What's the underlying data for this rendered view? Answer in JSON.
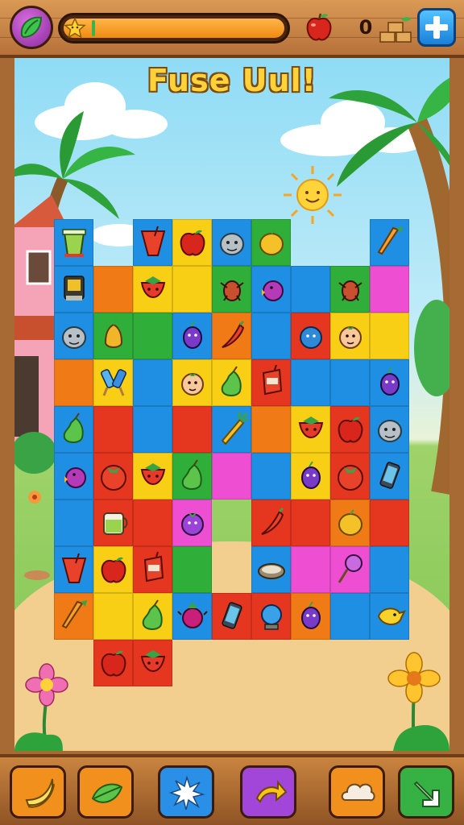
{
  "game": {
    "title": "Fuse Uul!",
    "coins": "0",
    "level_progress": 0.02,
    "colors": {
      "red": "#e5361f",
      "orange": "#f07a16",
      "yellow": "#f8cf14",
      "green": "#2fae3a",
      "blue": "#1e8fe3",
      "magenta": "#ee4fd2",
      "purple_powerup": "#9a43d6"
    }
  },
  "topbar": {
    "logo_icon": "leaf-swirl-icon",
    "star_icon": "star-icon",
    "apple_icon": "apple-icon",
    "bricks_icon": "bricks-icon",
    "plus_icon": "plus-icon"
  },
  "board": {
    "columns": 9,
    "rows": 10,
    "tiles": [
      {
        "r": 0,
        "c": 0,
        "color": "blue",
        "item": "smoothie-cup"
      },
      {
        "r": 0,
        "c": 2,
        "color": "blue",
        "item": "red-drink"
      },
      {
        "r": 0,
        "c": 3,
        "color": "yellow",
        "item": "apple"
      },
      {
        "r": 0,
        "c": 4,
        "color": "blue",
        "item": "robot-face"
      },
      {
        "r": 0,
        "c": 5,
        "color": "green",
        "item": "mango"
      },
      {
        "r": 0,
        "c": 8,
        "color": "blue",
        "item": "carrot"
      },
      {
        "r": 1,
        "c": 0,
        "color": "blue",
        "item": "gadget"
      },
      {
        "r": 1,
        "c": 1,
        "color": "orange",
        "item": ""
      },
      {
        "r": 1,
        "c": 2,
        "color": "yellow",
        "item": "strawberry-face"
      },
      {
        "r": 1,
        "c": 3,
        "color": "yellow",
        "item": ""
      },
      {
        "r": 1,
        "c": 4,
        "color": "green",
        "item": "ant-critter"
      },
      {
        "r": 1,
        "c": 5,
        "color": "blue",
        "item": "plum-bird"
      },
      {
        "r": 1,
        "c": 6,
        "color": "blue",
        "item": ""
      },
      {
        "r": 1,
        "c": 7,
        "color": "green",
        "item": "ant-critter"
      },
      {
        "r": 1,
        "c": 8,
        "color": "magenta",
        "item": ""
      },
      {
        "r": 2,
        "c": 0,
        "color": "blue",
        "item": "robot-face"
      },
      {
        "r": 2,
        "c": 1,
        "color": "green",
        "item": "pear-critter"
      },
      {
        "r": 2,
        "c": 2,
        "color": "green",
        "item": ""
      },
      {
        "r": 2,
        "c": 3,
        "color": "blue",
        "item": "grape-critter"
      },
      {
        "r": 2,
        "c": 4,
        "color": "orange",
        "item": "chili"
      },
      {
        "r": 2,
        "c": 5,
        "color": "blue",
        "item": ""
      },
      {
        "r": 2,
        "c": 6,
        "color": "red",
        "item": "blueberry-critter"
      },
      {
        "r": 2,
        "c": 7,
        "color": "yellow",
        "item": "peach-face"
      },
      {
        "r": 2,
        "c": 8,
        "color": "yellow",
        "item": ""
      },
      {
        "r": 3,
        "c": 0,
        "color": "orange",
        "item": ""
      },
      {
        "r": 3,
        "c": 1,
        "color": "yellow",
        "item": "popsicles"
      },
      {
        "r": 3,
        "c": 2,
        "color": "blue",
        "item": ""
      },
      {
        "r": 3,
        "c": 3,
        "color": "yellow",
        "item": "peach-face"
      },
      {
        "r": 3,
        "c": 4,
        "color": "yellow",
        "item": "green-pear"
      },
      {
        "r": 3,
        "c": 5,
        "color": "red",
        "item": "juice-box"
      },
      {
        "r": 3,
        "c": 6,
        "color": "blue",
        "item": ""
      },
      {
        "r": 3,
        "c": 7,
        "color": "blue",
        "item": ""
      },
      {
        "r": 3,
        "c": 8,
        "color": "blue",
        "item": "grape-critter"
      },
      {
        "r": 4,
        "c": 0,
        "color": "blue",
        "item": "green-pear"
      },
      {
        "r": 4,
        "c": 1,
        "color": "red",
        "item": ""
      },
      {
        "r": 4,
        "c": 2,
        "color": "blue",
        "item": ""
      },
      {
        "r": 4,
        "c": 3,
        "color": "red",
        "item": ""
      },
      {
        "r": 4,
        "c": 4,
        "color": "blue",
        "item": "pineapple"
      },
      {
        "r": 4,
        "c": 5,
        "color": "orange",
        "item": ""
      },
      {
        "r": 4,
        "c": 6,
        "color": "yellow",
        "item": "strawberry-face"
      },
      {
        "r": 4,
        "c": 7,
        "color": "red",
        "item": "apple"
      },
      {
        "r": 4,
        "c": 8,
        "color": "blue",
        "item": "robot-face"
      },
      {
        "r": 5,
        "c": 0,
        "color": "blue",
        "item": "plum-bird"
      },
      {
        "r": 5,
        "c": 1,
        "color": "red",
        "item": "tomato"
      },
      {
        "r": 5,
        "c": 2,
        "color": "yellow",
        "item": "strawberry-face"
      },
      {
        "r": 5,
        "c": 3,
        "color": "green",
        "item": "green-pear"
      },
      {
        "r": 5,
        "c": 4,
        "color": "magenta",
        "item": ""
      },
      {
        "r": 5,
        "c": 5,
        "color": "blue",
        "item": ""
      },
      {
        "r": 5,
        "c": 6,
        "color": "yellow",
        "item": "grape-critter"
      },
      {
        "r": 5,
        "c": 7,
        "color": "red",
        "item": "tomato"
      },
      {
        "r": 5,
        "c": 8,
        "color": "blue",
        "item": "phone"
      },
      {
        "r": 6,
        "c": 0,
        "color": "blue",
        "item": ""
      },
      {
        "r": 6,
        "c": 1,
        "color": "red",
        "item": "juice-jar"
      },
      {
        "r": 6,
        "c": 2,
        "color": "red",
        "item": ""
      },
      {
        "r": 6,
        "c": 3,
        "color": "magenta",
        "item": "purple-critter"
      },
      {
        "r": 6,
        "c": 5,
        "color": "red",
        "item": "chili"
      },
      {
        "r": 6,
        "c": 6,
        "color": "red",
        "item": ""
      },
      {
        "r": 6,
        "c": 7,
        "color": "orange",
        "item": "mango"
      },
      {
        "r": 6,
        "c": 8,
        "color": "red",
        "item": ""
      },
      {
        "r": 7,
        "c": 0,
        "color": "blue",
        "item": "red-drink"
      },
      {
        "r": 7,
        "c": 1,
        "color": "yellow",
        "item": "apple"
      },
      {
        "r": 7,
        "c": 2,
        "color": "red",
        "item": "juice-box"
      },
      {
        "r": 7,
        "c": 3,
        "color": "green",
        "item": ""
      },
      {
        "r": 7,
        "c": 5,
        "color": "blue",
        "item": "coconut"
      },
      {
        "r": 7,
        "c": 6,
        "color": "magenta",
        "item": ""
      },
      {
        "r": 7,
        "c": 7,
        "color": "magenta",
        "item": "lollipop"
      },
      {
        "r": 7,
        "c": 8,
        "color": "blue",
        "item": ""
      },
      {
        "r": 8,
        "c": 0,
        "color": "orange",
        "item": "carrot"
      },
      {
        "r": 8,
        "c": 1,
        "color": "yellow",
        "item": ""
      },
      {
        "r": 8,
        "c": 2,
        "color": "yellow",
        "item": "green-pear"
      },
      {
        "r": 8,
        "c": 3,
        "color": "blue",
        "item": "beet-critter"
      },
      {
        "r": 8,
        "c": 4,
        "color": "red",
        "item": "phone"
      },
      {
        "r": 8,
        "c": 5,
        "color": "red",
        "item": "blue-lamp"
      },
      {
        "r": 8,
        "c": 6,
        "color": "orange",
        "item": "grape-critter"
      },
      {
        "r": 8,
        "c": 7,
        "color": "blue",
        "item": ""
      },
      {
        "r": 8,
        "c": 8,
        "color": "blue",
        "item": "yellow-bird"
      },
      {
        "r": 9,
        "c": 1,
        "color": "red",
        "item": "apple"
      },
      {
        "r": 9,
        "c": 2,
        "color": "red",
        "item": "strawberry-face"
      }
    ]
  },
  "powerups": [
    {
      "id": "banana",
      "icon": "banana-icon",
      "color": "#f2901e"
    },
    {
      "id": "leaf",
      "icon": "leaf-icon",
      "color": "#f2901e"
    },
    {
      "id": "sparkle",
      "icon": "sparkle-icon",
      "color": "#2a8fe6"
    },
    {
      "id": "arrow",
      "icon": "curved-arrow-icon",
      "color": "#a146d8"
    },
    {
      "id": "cloud",
      "icon": "cloud-icon",
      "color": "#f2901e"
    },
    {
      "id": "swap",
      "icon": "swap-arrow-icon",
      "color": "#36b143"
    }
  ]
}
